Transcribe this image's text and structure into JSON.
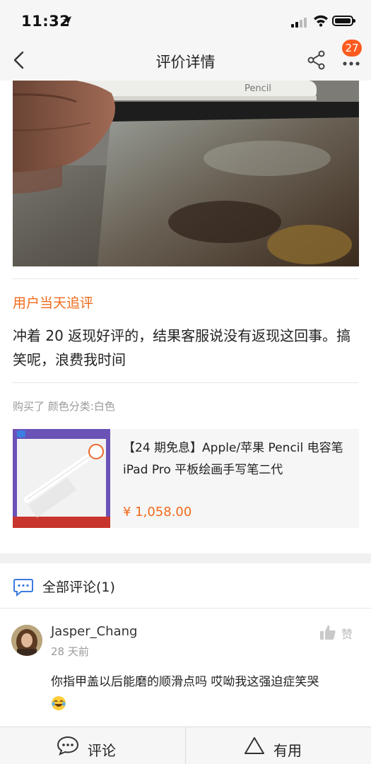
{
  "status_bar": {
    "time": "11:32"
  },
  "header": {
    "title": "评价详情",
    "notification_count": "27"
  },
  "review": {
    "followup_label": "用户当天追评",
    "text": "冲着 20 返现好评的，结果客服说没有返现这回事。搞笑呢，浪费我时间",
    "purchase_info": "购买了 颜色分类:白色"
  },
  "product": {
    "name": "【24 期免息】Apple/苹果 Pencil 电容笔 iPad Pro 平板绘画手写笔二代",
    "price": "¥ 1,058.00"
  },
  "comments": {
    "header": "全部评论(1)",
    "items": [
      {
        "user": "Jasper_Chang",
        "date": "28 天前",
        "like_label": "赞",
        "text": "你指甲盖以后能磨的顺滑点吗  哎呦我这强迫症笑哭"
      }
    ]
  },
  "bottom_bar": {
    "comment_label": "评论",
    "useful_label": "有用"
  },
  "colors": {
    "accent": "#f26a1b",
    "badge": "#ff5b1f"
  }
}
